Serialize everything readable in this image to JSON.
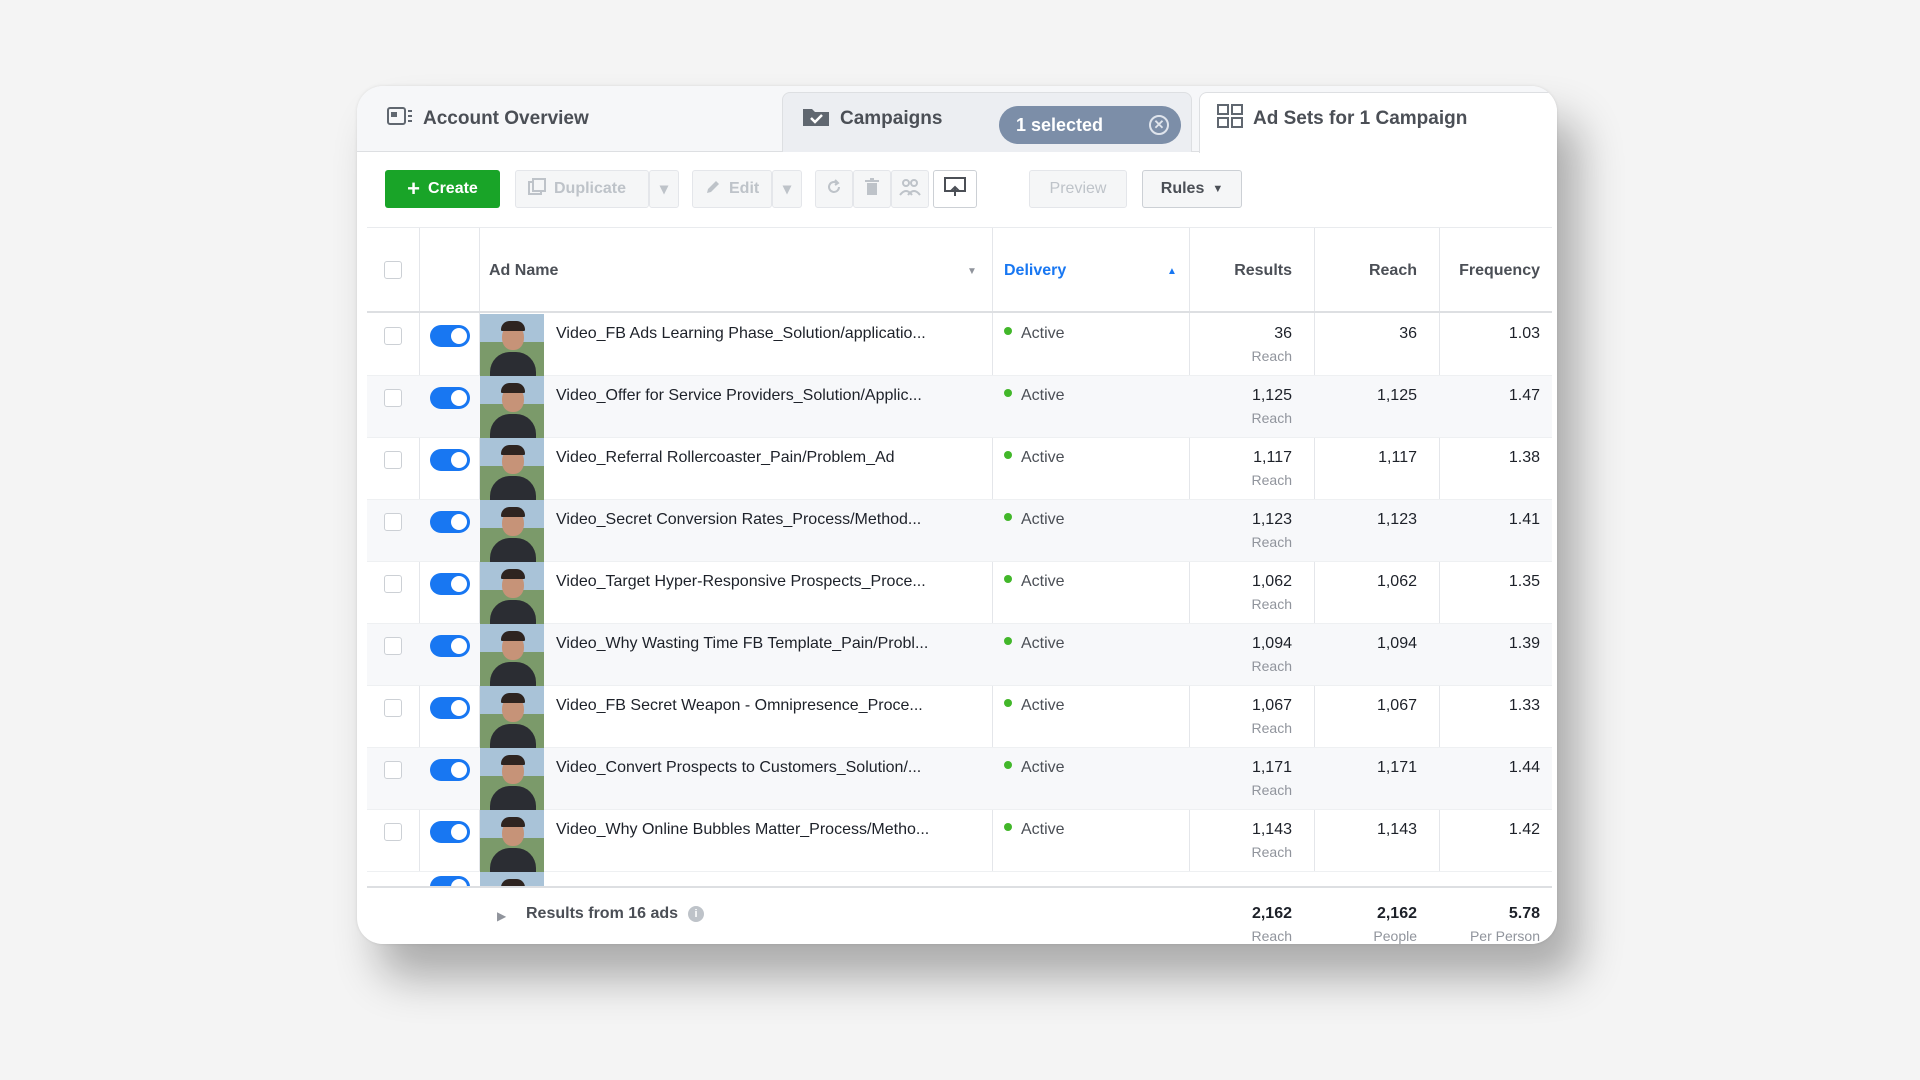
{
  "tabs": {
    "account_overview": "Account Overview",
    "campaigns": "Campaigns",
    "selected_pill": "1 selected",
    "ad_sets": "Ad Sets for 1 Campaign"
  },
  "toolbar": {
    "create": "Create",
    "duplicate": "Duplicate",
    "edit": "Edit",
    "preview": "Preview",
    "rules": "Rules"
  },
  "table": {
    "headers": {
      "ad_name": "Ad Name",
      "delivery": "Delivery",
      "results": "Results",
      "reach": "Reach",
      "frequency": "Frequency"
    },
    "rows": [
      {
        "name": "Video_FB Ads Learning Phase_Solution/applicatio...",
        "delivery": "Active",
        "results": "36",
        "results_label": "Reach",
        "reach": "36",
        "frequency": "1.03"
      },
      {
        "name": "Video_Offer for Service Providers_Solution/Applic...",
        "delivery": "Active",
        "results": "1,125",
        "results_label": "Reach",
        "reach": "1,125",
        "frequency": "1.47"
      },
      {
        "name": "Video_Referral Rollercoaster_Pain/Problem_Ad",
        "delivery": "Active",
        "results": "1,117",
        "results_label": "Reach",
        "reach": "1,117",
        "frequency": "1.38"
      },
      {
        "name": "Video_Secret Conversion Rates_Process/Method...",
        "delivery": "Active",
        "results": "1,123",
        "results_label": "Reach",
        "reach": "1,123",
        "frequency": "1.41"
      },
      {
        "name": "Video_Target Hyper-Responsive Prospects_Proce...",
        "delivery": "Active",
        "results": "1,062",
        "results_label": "Reach",
        "reach": "1,062",
        "frequency": "1.35"
      },
      {
        "name": "Video_Why Wasting Time FB Template_Pain/Probl...",
        "delivery": "Active",
        "results": "1,094",
        "results_label": "Reach",
        "reach": "1,094",
        "frequency": "1.39"
      },
      {
        "name": "Video_FB Secret Weapon - Omnipresence_Proce...",
        "delivery": "Active",
        "results": "1,067",
        "results_label": "Reach",
        "reach": "1,067",
        "frequency": "1.33"
      },
      {
        "name": "Video_Convert Prospects to Customers_Solution/...",
        "delivery": "Active",
        "results": "1,171",
        "results_label": "Reach",
        "reach": "1,171",
        "frequency": "1.44"
      },
      {
        "name": "Video_Why Online Bubbles Matter_Process/Metho...",
        "delivery": "Active",
        "results": "1,143",
        "results_label": "Reach",
        "reach": "1,143",
        "frequency": "1.42"
      }
    ],
    "footer": {
      "label": "Results from 16 ads",
      "results": "2,162",
      "results_label": "Reach",
      "reach": "2,162",
      "reach_label": "People",
      "frequency": "5.78",
      "frequency_label": "Per Person"
    }
  },
  "colors": {
    "create_green": "#19a428",
    "toggle_blue": "#1877f2",
    "active_dot": "#42b72a",
    "selected_pill": "#7c8ea8"
  }
}
